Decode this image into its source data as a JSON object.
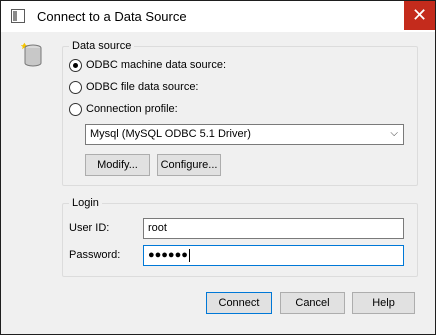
{
  "window": {
    "title": "Connect to a Data Source",
    "close_glyph": "✕"
  },
  "data_source": {
    "group_label": "Data source",
    "machine_label": "ODBC machine data source:",
    "file_label": "ODBC file data source:",
    "profile_label": "Connection profile:",
    "selected_source": "Mysql (MySQL ODBC 5.1 Driver)",
    "modify_label": "Modify...",
    "configure_label": "Configure..."
  },
  "login": {
    "group_label": "Login",
    "userid_label": "User ID:",
    "userid_value": "root",
    "password_label": "Password:",
    "password_value": "●●●●●●"
  },
  "buttons": {
    "connect_label": "Connect",
    "cancel_label": "Cancel",
    "help_label": "Help"
  }
}
